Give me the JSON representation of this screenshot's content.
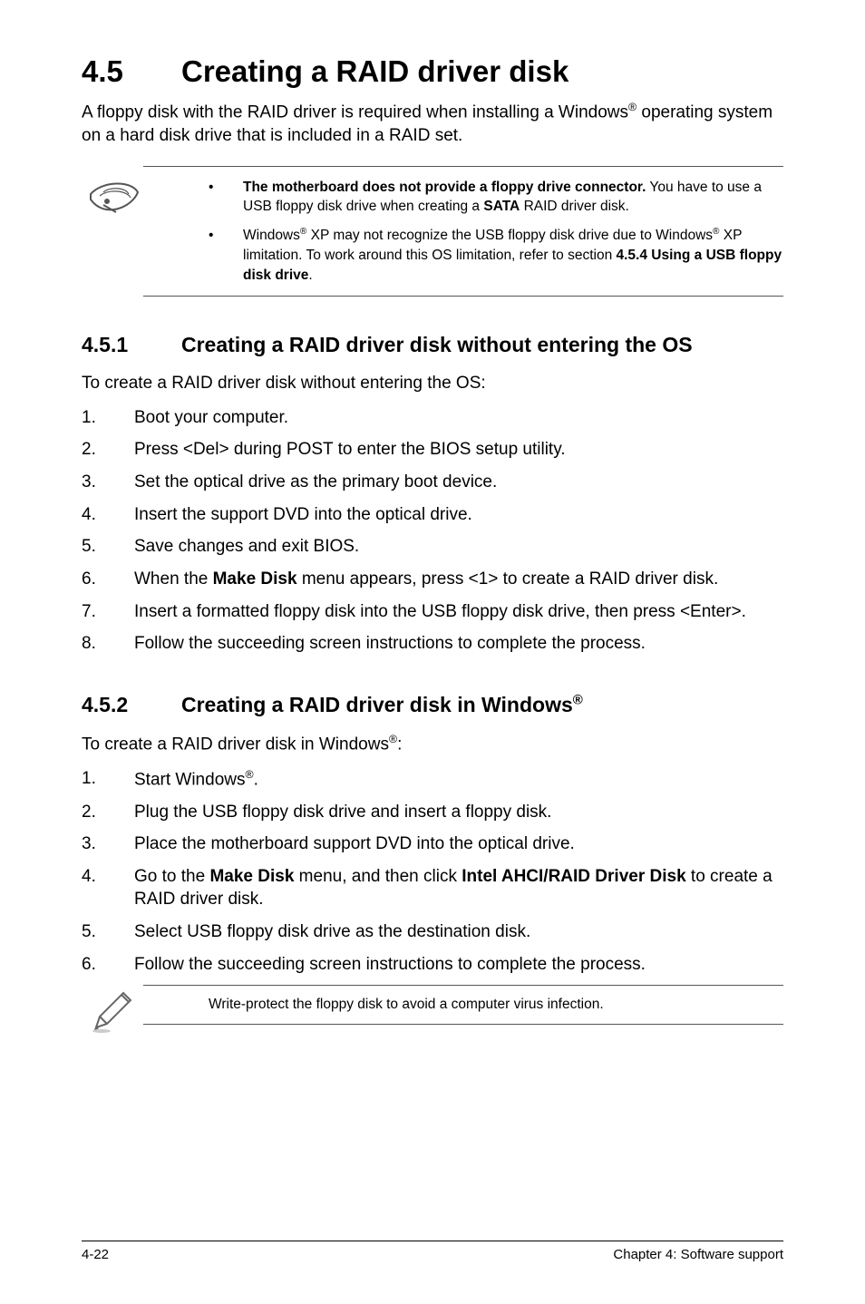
{
  "heading": {
    "number": "4.5",
    "title": "Creating a RAID driver disk"
  },
  "intro": {
    "part1": "A floppy disk with the RAID driver is required when installing a Windows",
    "part2": " operating system on a hard disk drive that is included in a RAID set."
  },
  "note": {
    "items": [
      {
        "bold1": "The motherboard does not provide a floppy drive connector.",
        "text1": " You have to use a USB floppy disk drive when creating a ",
        "bold2": "SATA",
        "text2": " RAID driver disk."
      },
      {
        "text1": "Windows",
        "text2": " XP may not recognize the USB floppy disk drive due to Windows",
        "text3": " XP limitation. To work around this OS limitation, refer to section ",
        "bold1": "4.5.4 Using a USB floppy disk drive",
        "text4": "."
      }
    ]
  },
  "section1": {
    "number": "4.5.1",
    "title": "Creating a RAID driver disk without entering the OS",
    "lead": "To create a RAID driver disk without entering the OS:",
    "steps": [
      "Boot your computer.",
      "Press <Del> during POST to enter the BIOS setup utility.",
      "Set the optical drive as the primary boot device.",
      "Insert the support DVD into the optical drive.",
      "Save changes and exit BIOS."
    ],
    "step6": {
      "pre": "When the ",
      "bold": "Make Disk",
      "post": " menu appears, press <1> to create a RAID driver disk."
    },
    "step7": "Insert a formatted floppy disk into the USB floppy disk drive, then press <Enter>.",
    "step8": "Follow the succeeding screen instructions to complete the process."
  },
  "section2": {
    "number": "4.5.2",
    "title_pre": "Creating a RAID driver disk in Windows",
    "lead_pre": "To create a RAID driver disk in Windows",
    "lead_post": ":",
    "step1_pre": "Start Windows",
    "step1_post": ".",
    "step2": "Plug the USB floppy disk drive and insert a floppy disk.",
    "step3": "Place the motherboard support DVD into the optical drive.",
    "step4": {
      "t1": "Go to the ",
      "b1": "Make Disk",
      "t2": " menu, and then click ",
      "b2": "Intel AHCI/RAID Driver Disk",
      "t3": " to create a RAID driver disk."
    },
    "step5": "Select USB floppy disk drive as the destination disk.",
    "step6": "Follow the succeeding screen instructions to complete the process."
  },
  "tip": "Write-protect the floppy disk to avoid a computer virus infection.",
  "footer": {
    "left": "4-22",
    "right": "Chapter 4: Software support"
  }
}
